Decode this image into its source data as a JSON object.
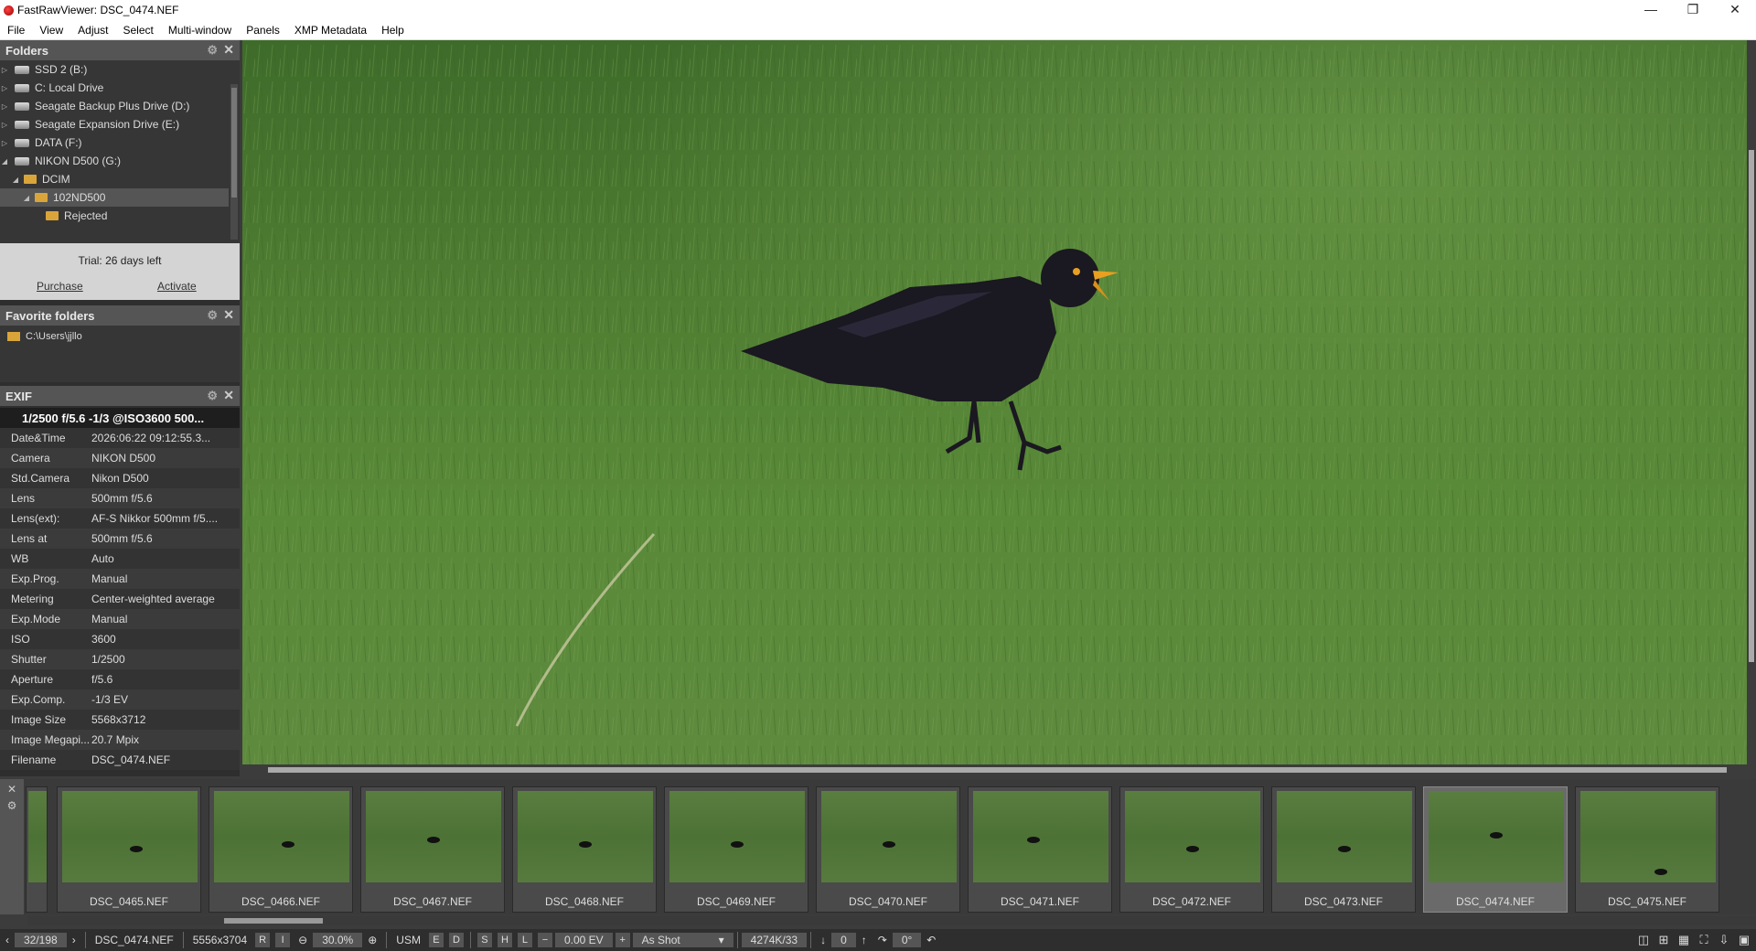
{
  "window": {
    "title": "FastRawViewer: DSC_0474.NEF",
    "minimize": "—",
    "maximize": "❐",
    "close": "✕"
  },
  "menu": [
    "File",
    "View",
    "Adjust",
    "Select",
    "Multi-window",
    "Panels",
    "XMP Metadata",
    "Help"
  ],
  "folders_panel": {
    "title": "Folders",
    "items": [
      {
        "label": "SSD 2 (B:)",
        "type": "drive",
        "arrow": "▷",
        "indent": 0
      },
      {
        "label": "C: Local Drive",
        "type": "drive",
        "arrow": "▷",
        "indent": 0
      },
      {
        "label": "Seagate Backup Plus Drive (D:)",
        "type": "drive",
        "arrow": "▷",
        "indent": 0
      },
      {
        "label": "Seagate Expansion Drive (E:)",
        "type": "drive",
        "arrow": "▷",
        "indent": 0
      },
      {
        "label": "DATA (F:)",
        "type": "drive",
        "arrow": "▷",
        "indent": 0
      },
      {
        "label": "NIKON D500  (G:)",
        "type": "drive",
        "arrow": "◢",
        "indent": 0
      },
      {
        "label": "DCIM",
        "type": "folder",
        "arrow": "◢",
        "indent": 1
      },
      {
        "label": "102ND500",
        "type": "folder",
        "arrow": "◢",
        "indent": 2,
        "selected": true
      },
      {
        "label": "Rejected",
        "type": "folder",
        "arrow": "",
        "indent": 3
      }
    ]
  },
  "trial": {
    "text": "Trial: 26 days left",
    "purchase": "Purchase",
    "activate": "Activate"
  },
  "favorites_panel": {
    "title": "Favorite folders",
    "items": [
      "C:\\Users\\jjllo"
    ]
  },
  "exif_panel": {
    "title": "EXIF",
    "summary": "1/2500 f/5.6 -1/3 @ISO3600 500...",
    "rows": [
      {
        "k": "Date&Time",
        "v": "2026:06:22 09:12:55.3..."
      },
      {
        "k": "Camera",
        "v": "NIKON D500"
      },
      {
        "k": "Std.Camera",
        "v": "Nikon D500"
      },
      {
        "k": "Lens",
        "v": "500mm f/5.6"
      },
      {
        "k": "Lens(ext):",
        "v": "AF-S Nikkor 500mm f/5...."
      },
      {
        "k": "Lens at",
        "v": "500mm f/5.6"
      },
      {
        "k": "WB",
        "v": "Auto"
      },
      {
        "k": "Exp.Prog.",
        "v": "Manual"
      },
      {
        "k": "Metering",
        "v": "Center-weighted average"
      },
      {
        "k": "Exp.Mode",
        "v": "Manual"
      },
      {
        "k": "ISO",
        "v": "3600"
      },
      {
        "k": "Shutter",
        "v": "1/2500"
      },
      {
        "k": "Aperture",
        "v": "f/5.6"
      },
      {
        "k": "Exp.Comp.",
        "v": "-1/3 EV"
      },
      {
        "k": "Image Size",
        "v": "5568x3712"
      },
      {
        "k": "Image Megapi...",
        "v": "20.7 Mpix"
      },
      {
        "k": "Filename",
        "v": "DSC_0474.NEF"
      }
    ]
  },
  "filmstrip": {
    "items": [
      {
        "name": "DSC_0465.NEF",
        "bird": [
          0.5,
          0.6
        ]
      },
      {
        "name": "DSC_0466.NEF",
        "bird": [
          0.5,
          0.55
        ]
      },
      {
        "name": "DSC_0467.NEF",
        "bird": [
          0.45,
          0.5
        ]
      },
      {
        "name": "DSC_0468.NEF",
        "bird": [
          0.45,
          0.55
        ]
      },
      {
        "name": "DSC_0469.NEF",
        "bird": [
          0.45,
          0.55
        ]
      },
      {
        "name": "DSC_0470.NEF",
        "bird": [
          0.45,
          0.55
        ]
      },
      {
        "name": "DSC_0471.NEF",
        "bird": [
          0.4,
          0.5
        ]
      },
      {
        "name": "DSC_0472.NEF",
        "bird": [
          0.45,
          0.6
        ]
      },
      {
        "name": "DSC_0473.NEF",
        "bird": [
          0.45,
          0.6
        ]
      },
      {
        "name": "DSC_0474.NEF",
        "bird": [
          0.45,
          0.45
        ],
        "selected": true
      },
      {
        "name": "DSC_0475.NEF",
        "bird": [
          0.55,
          0.85
        ]
      }
    ]
  },
  "status": {
    "position": "32/198",
    "filename": "DSC_0474.NEF",
    "size": "5556x3704",
    "r": "R",
    "i": "I",
    "zoom": "30.0%",
    "usm": "USM",
    "e": "E",
    "d": "D",
    "s": "S",
    "h": "H",
    "l": "L",
    "ev": "0.00 EV",
    "wb": "As Shot",
    "mem": "4274K/33",
    "rating": "0",
    "rotation": "0°"
  },
  "colors": {
    "selection": "#555555",
    "panel_header": "#555555",
    "trial_bg": "#d4d4d4"
  }
}
